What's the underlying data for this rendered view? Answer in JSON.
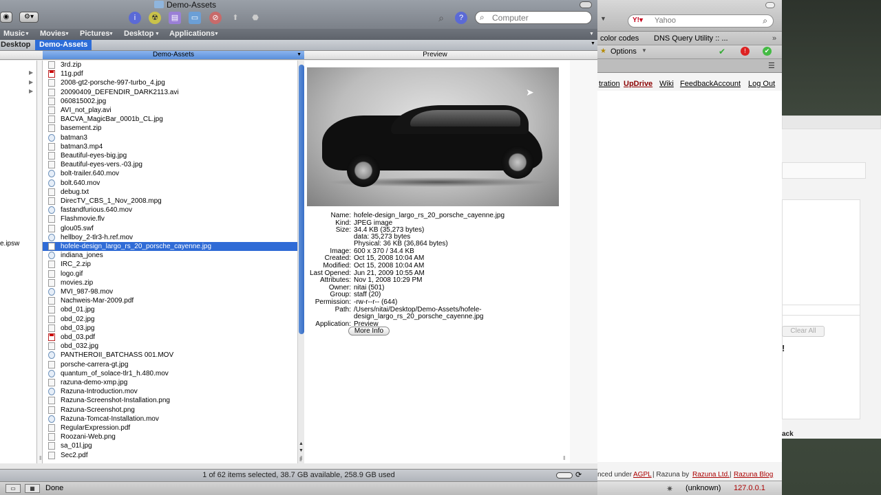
{
  "finder": {
    "title": "Demo-Assets",
    "search_placeholder": "Computer",
    "places": [
      "Music",
      "Movies",
      "Pictures",
      "Desktop",
      "Applications"
    ],
    "path": [
      "Desktop",
      "Demo-Assets"
    ],
    "column_header_files": "Demo-Assets",
    "column_header_preview": "Preview",
    "left_fragment": "e.ipsw",
    "files": [
      {
        "name": "3rd.zip",
        "type": "doc"
      },
      {
        "name": "11g.pdf",
        "type": "pdf"
      },
      {
        "name": "2008-gt2-porsche-997-turbo_4.jpg",
        "type": "doc"
      },
      {
        "name": "20090409_DEFENDIR_DARK2113.avi",
        "type": "doc"
      },
      {
        "name": "060815002.jpg",
        "type": "doc"
      },
      {
        "name": "AVI_not_play.avi",
        "type": "doc"
      },
      {
        "name": "BACVA_MagicBar_0001b_CL.jpg",
        "type": "doc"
      },
      {
        "name": "basement.zip",
        "type": "doc"
      },
      {
        "name": "batman3",
        "type": "mov"
      },
      {
        "name": "batman3.mp4",
        "type": "doc"
      },
      {
        "name": "Beautiful-eyes-big.jpg",
        "type": "doc"
      },
      {
        "name": "Beautiful-eyes-vers.-03.jpg",
        "type": "doc"
      },
      {
        "name": "bolt-trailer.640.mov",
        "type": "mov"
      },
      {
        "name": "bolt.640.mov",
        "type": "mov"
      },
      {
        "name": "debug.txt",
        "type": "doc"
      },
      {
        "name": "DirecTV_CBS_1_Nov_2008.mpg",
        "type": "doc"
      },
      {
        "name": "fastandfurious.640.mov",
        "type": "mov"
      },
      {
        "name": "Flashmovie.flv",
        "type": "doc"
      },
      {
        "name": "glou05.swf",
        "type": "doc"
      },
      {
        "name": "hellboy_2-tlr3-h.ref.mov",
        "type": "mov"
      },
      {
        "name": "hofele-design_largo_rs_20_porsche_cayenne.jpg",
        "type": "doc",
        "selected": true
      },
      {
        "name": "indiana_jones",
        "type": "mov"
      },
      {
        "name": "IRC_2.zip",
        "type": "doc"
      },
      {
        "name": "logo.gif",
        "type": "doc"
      },
      {
        "name": "movies.zip",
        "type": "doc"
      },
      {
        "name": "MVI_987-98.mov",
        "type": "mov"
      },
      {
        "name": "Nachweis-Mar-2009.pdf",
        "type": "doc"
      },
      {
        "name": "obd_01.jpg",
        "type": "doc"
      },
      {
        "name": "obd_02.jpg",
        "type": "doc"
      },
      {
        "name": "obd_03.jpg",
        "type": "doc"
      },
      {
        "name": "obd_03.pdf",
        "type": "pdf"
      },
      {
        "name": "obd_032.jpg",
        "type": "doc"
      },
      {
        "name": "PANTHEROII_BATCHASS 001.MOV",
        "type": "mov"
      },
      {
        "name": "porsche-carrera-gt.jpg",
        "type": "doc"
      },
      {
        "name": "quantum_of_solace-tlr1_h.480.mov",
        "type": "mov"
      },
      {
        "name": "razuna-demo-xmp.jpg",
        "type": "doc"
      },
      {
        "name": "Razuna-Introduction.mov",
        "type": "mov"
      },
      {
        "name": "Razuna-Screenshot-Installation.png",
        "type": "doc"
      },
      {
        "name": "Razuna-Screenshot.png",
        "type": "doc"
      },
      {
        "name": "Razuna-Tomcat-Installation.mov",
        "type": "mov"
      },
      {
        "name": "RegularExpression.pdf",
        "type": "doc"
      },
      {
        "name": "Roozani-Web.png",
        "type": "doc"
      },
      {
        "name": "sa_01l.jpg",
        "type": "doc"
      },
      {
        "name": "Sec2.pdf",
        "type": "doc"
      }
    ],
    "info": [
      {
        "label": "Name:",
        "value": "hofele-design_largo_rs_20_porsche_cayenne.jpg"
      },
      {
        "label": "Kind:",
        "value": "JPEG image"
      },
      {
        "label": "Size:",
        "value": "34.4 KB (35,273 bytes)"
      },
      {
        "label": "",
        "value": "data: 35,273 bytes"
      },
      {
        "label": "",
        "value": "Physical: 36 KB (36,864 bytes)"
      },
      {
        "label": "Image:",
        "value": "600 x 370 / 34.4 KB"
      },
      {
        "label": "Created:",
        "value": "Oct 15, 2008 10:04 AM"
      },
      {
        "label": "Modified:",
        "value": "Oct 15, 2008 10:04 AM"
      },
      {
        "label": "Last Opened:",
        "value": "Jun 21, 2009 10:55 AM"
      },
      {
        "label": "Attributes:",
        "value": "Nov 1, 2008 10:29 PM"
      },
      {
        "label": "Owner:",
        "value": "nitai (501)"
      },
      {
        "label": "Group:",
        "value": "staff (20)"
      },
      {
        "label": "Permission:",
        "value": "-rw-r--r-- (644)"
      },
      {
        "label": "Path:",
        "value": "/Users/nitai/Desktop/Demo-Assets/hofele-"
      },
      {
        "label": "",
        "value": "design_largo_rs_20_porsche_cayenne.jpg"
      },
      {
        "label": "Application:",
        "value": "Preview"
      }
    ],
    "more_info_label": "More Info",
    "status_text": "1 of 62 items selected, 38.7 GB available, 258.9 GB used",
    "done_label": "Done"
  },
  "browser": {
    "search_engine": "Yahoo",
    "bookmarks": [
      "color codes",
      "DNS Query Utility :: ..."
    ],
    "options_label": "Options",
    "nav_links": [
      "tration",
      "UpDrive",
      "Wiki",
      "FeedbackAccount",
      "Log Out"
    ],
    "clear_all": "Clear All",
    "exclaim": "!",
    "back_fragment": "ack",
    "footer_prefix": "nced under",
    "footer_agpl": "AGPL",
    "footer_mid": "| Razuna by",
    "footer_ltd": "Razuna Ltd.",
    "footer_sep": "|",
    "footer_blog": "Razuna Blog",
    "status_unknown": "(unknown)",
    "status_ip": "127.0.0.1"
  },
  "colors": {
    "selection": "#2f6bd6",
    "link_red": "#a00000"
  }
}
